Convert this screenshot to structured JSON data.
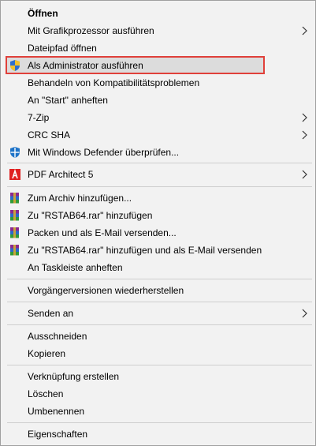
{
  "menu": {
    "items": [
      {
        "label": "Öffnen"
      },
      {
        "label": "Mit Grafikprozessor ausführen"
      },
      {
        "label": "Dateipfad öffnen"
      },
      {
        "label": "Als Administrator ausführen",
        "icon": "uac-shield-icon"
      },
      {
        "label": "Behandeln von Kompatibilitätsproblemen"
      },
      {
        "label": "An \"Start\" anheften"
      },
      {
        "label": "7-Zip"
      },
      {
        "label": "CRC SHA"
      },
      {
        "label": "Mit Windows Defender überprüfen...",
        "icon": "windows-defender-icon"
      },
      {
        "label": "PDF Architect 5",
        "icon": "pdf-architect-icon"
      },
      {
        "label": "Zum Archiv hinzufügen...",
        "icon": "winrar-icon"
      },
      {
        "label": "Zu \"RSTAB64.rar\" hinzufügen",
        "icon": "winrar-icon"
      },
      {
        "label": "Packen und als E-Mail versenden...",
        "icon": "winrar-icon"
      },
      {
        "label": "Zu \"RSTAB64.rar\" hinzufügen und als E-Mail versenden",
        "icon": "winrar-icon"
      },
      {
        "label": "An Taskleiste anheften"
      },
      {
        "label": "Vorgängerversionen wiederherstellen"
      },
      {
        "label": "Senden an"
      },
      {
        "label": "Ausschneiden"
      },
      {
        "label": "Kopieren"
      },
      {
        "label": "Verknüpfung erstellen"
      },
      {
        "label": "Löschen"
      },
      {
        "label": "Umbenennen"
      },
      {
        "label": "Eigenschaften"
      }
    ],
    "highlighted_item": "Als Administrator ausführen",
    "colors": {
      "background": "#f2f2f2",
      "hover": "#dcdcdc",
      "highlight_border": "#e0403a",
      "separator": "#cfcfcf"
    }
  }
}
